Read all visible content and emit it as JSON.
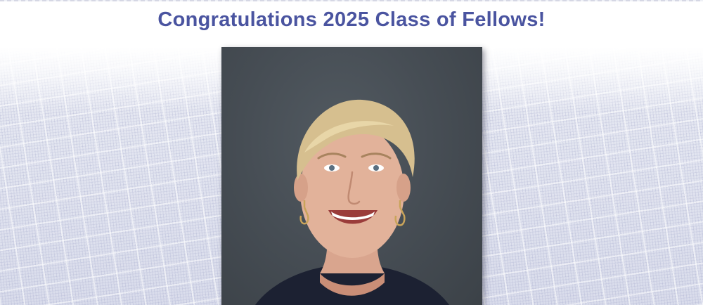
{
  "header": {
    "title": "Congratulations 2025 Class of Fellows!"
  },
  "portrait": {
    "subject": "portrait-photo"
  },
  "colors": {
    "title": "#4a54a0",
    "photo_background": "#4a5158",
    "texture": "#e4e6f0"
  }
}
